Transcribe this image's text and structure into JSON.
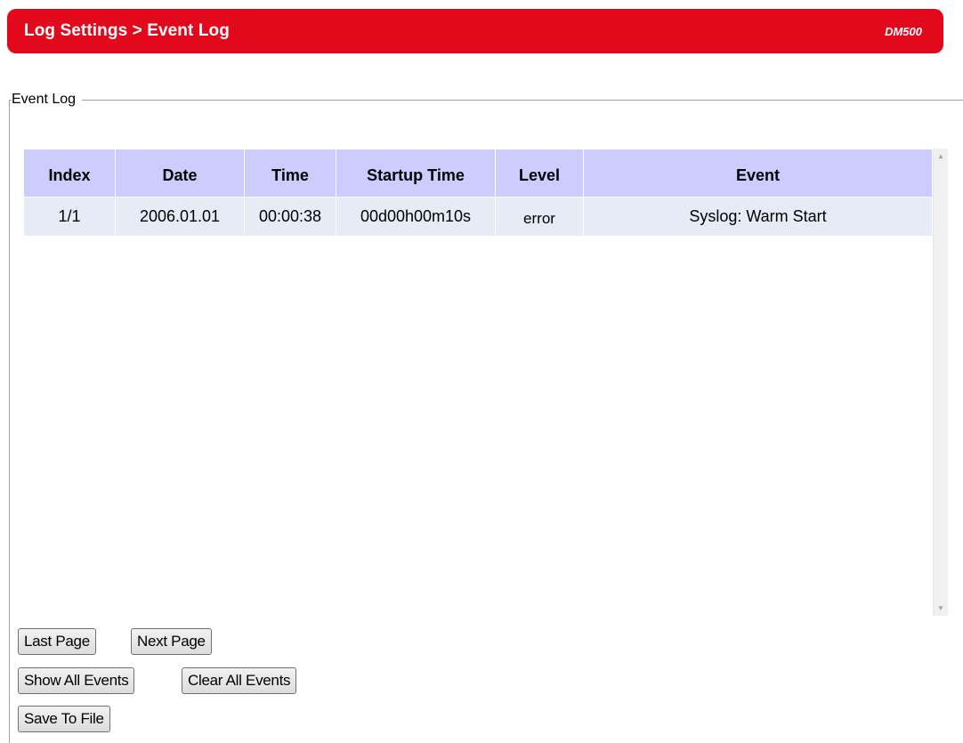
{
  "header": {
    "breadcrumb": "Log Settings > Event Log",
    "model": "DM500"
  },
  "section": {
    "legend": "Event Log"
  },
  "table": {
    "columns": [
      "Index",
      "Date",
      "Time",
      "Startup Time",
      "Level",
      "Event"
    ],
    "rows": [
      {
        "index": "1/1",
        "date": "2006.01.01",
        "time": "00:00:38",
        "startup_time": "00d00h00m10s",
        "level": "error",
        "event": "Syslog: Warm Start"
      }
    ]
  },
  "buttons": {
    "last_page": "Last Page",
    "next_page": "Next Page",
    "show_all_events": "Show All Events",
    "clear_all_events": "Clear All Events",
    "save_to_file": "Save To File"
  },
  "colors": {
    "header_bg": "#e2091d",
    "table_header_bg": "#ccccff",
    "table_row_bg": "#e6ecf6"
  }
}
